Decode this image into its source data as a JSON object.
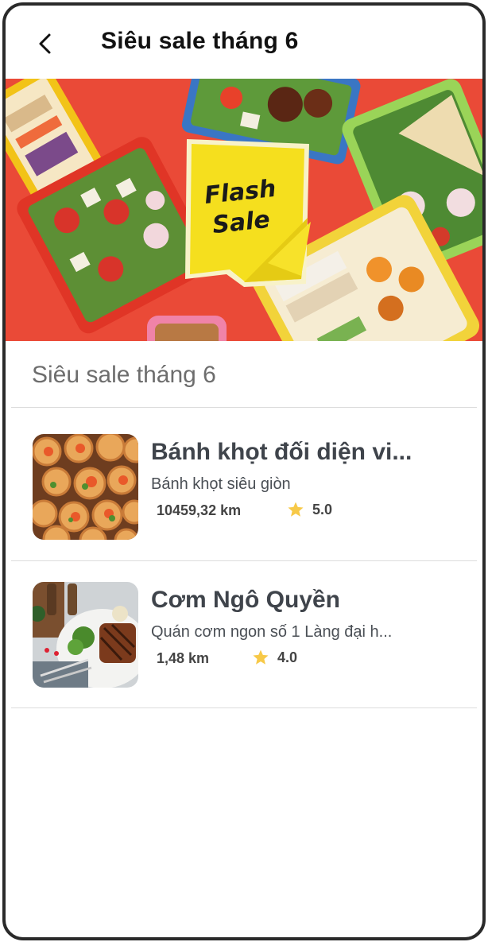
{
  "header": {
    "title": "Siêu sale tháng 6",
    "back_icon": "chevron-left-icon"
  },
  "banner": {
    "badge_line1": "Flash",
    "badge_line2": "Sale"
  },
  "section": {
    "title": "Siêu sale tháng 6"
  },
  "colors": {
    "star": "#f7c948",
    "banner_red": "#ea4a37",
    "badge_yellow": "#f5df1e"
  },
  "items": [
    {
      "name": "Bánh khọt đối diện vi...",
      "description": "Bánh khọt siêu giòn",
      "distance": "10459,32 km",
      "rating": "5.0",
      "image_icon": "banh-khot-photo"
    },
    {
      "name": "Cơm Ngô Quyền",
      "description": "Quán cơm ngon số 1 Làng đại h...",
      "distance": "1,48 km",
      "rating": "4.0",
      "image_icon": "com-steak-photo"
    }
  ]
}
